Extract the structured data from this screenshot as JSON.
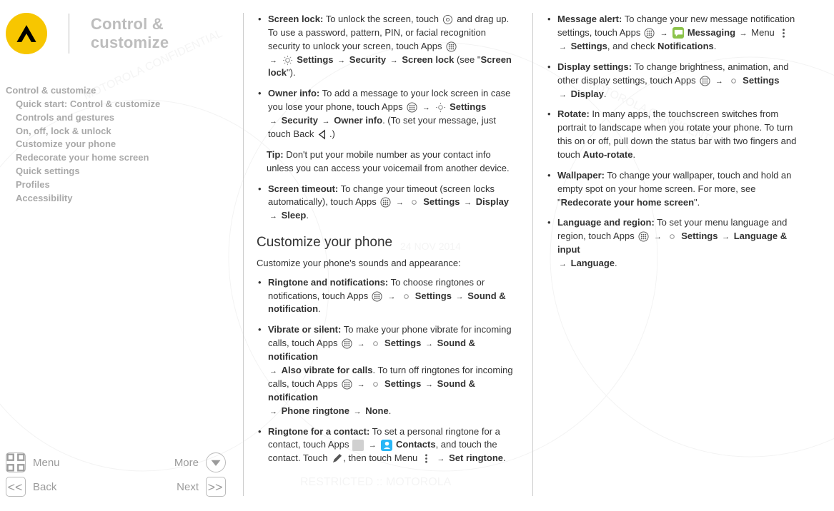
{
  "header": {
    "title": "Control & customize"
  },
  "toc": {
    "items": [
      {
        "label": "Control & customize",
        "level": 1
      },
      {
        "label": "Quick start: Control & customize",
        "level": 2
      },
      {
        "label": "Controls and gestures",
        "level": 2
      },
      {
        "label": "On, off, lock & unlock",
        "level": 2
      },
      {
        "label": "Customize your phone",
        "level": 2
      },
      {
        "label": "Redecorate your home screen",
        "level": 2
      },
      {
        "label": "Quick settings",
        "level": 2
      },
      {
        "label": "Profiles",
        "level": 2
      },
      {
        "label": "Accessibility",
        "level": 2
      }
    ]
  },
  "nav": {
    "menu": "Menu",
    "more": "More",
    "back": "Back",
    "next": "Next"
  },
  "col1": {
    "screen_lock": {
      "title": "Screen lock:",
      "t1": " To unlock the screen, touch ",
      "t2": " and drag up. To use a password, pattern, PIN, or facial recognition security to unlock your screen, touch Apps ",
      "p_settings": "Settings",
      "p_security": "Security",
      "p_screenlock": "Screen lock",
      "t3": " (see \"",
      "p_screenlock_link": "Screen lock",
      "t4": "\")."
    },
    "owner_info": {
      "title": "Owner info:",
      "t1": " To add a message to your lock screen in case you lose your phone, touch Apps ",
      "p_settings": "Settings",
      "p_security": "Security",
      "p_owner": "Owner info",
      "t2": ". (To set your message, just touch Back ",
      "t3": ".)"
    },
    "tip": {
      "title": "Tip:",
      "text": " Don't put your mobile number as your contact info unless you can access your voicemail from another device."
    },
    "screen_timeout": {
      "title": "Screen timeout:",
      "t1": " To change your timeout (screen locks automatically), touch Apps ",
      "p_settings": "Settings",
      "p_display": "Display",
      "p_sleep": "Sleep",
      "t2": "."
    },
    "heading": "Customize your phone",
    "intro": "Customize your phone's sounds and appearance:",
    "ringtone": {
      "title": "Ringtone and notifications:",
      "t1": " To choose ringtones or notifications, touch Apps ",
      "p_settings": "Settings",
      "p_sound": "Sound & notification",
      "t2": "."
    },
    "vibrate": {
      "title": "Vibrate or silent:",
      "t1": " To make your phone vibrate for incoming calls, touch Apps ",
      "p_settings": "Settings",
      "p_sound": "Sound & notification",
      "p_also": "Also vibrate for calls",
      "t2": ". To turn off ringtones for incoming calls, touch Apps ",
      "p_sound2": "Sound & notification",
      "p_ringtone": "Phone ringtone",
      "p_none": "None",
      "t3": "."
    },
    "contact_ringtone": {
      "title": "Ringtone for a contact:",
      "t1": " To set a personal ringtone for a contact, touch Apps ",
      "p_contacts": "Contacts",
      "t2": ", and touch the contact. Touch ",
      "t3": ", then touch Menu ",
      "p_set": "Set ringtone",
      "t4": "."
    }
  },
  "col2": {
    "msg_alert": {
      "title": "Message alert:",
      "t1": " To change your new message notification settings, touch Apps ",
      "p_messaging": "Messaging",
      "t2": " Menu ",
      "p_settings": "Settings",
      "t3": ", and check ",
      "p_notifications": "Notifications",
      "t4": "."
    },
    "display": {
      "title": "Display settings:",
      "t1": " To change brightness, animation, and other display settings, touch Apps ",
      "p_settings": "Settings",
      "p_display": "Display",
      "t2": "."
    },
    "rotate": {
      "title": "Rotate:",
      "t1": " In many apps, the touchscreen switches from portrait to landscape when you rotate your phone. To turn this on or off, pull down the status bar with two fingers and touch ",
      "p_auto": "Auto-rotate",
      "t2": "."
    },
    "wallpaper": {
      "title": "Wallpaper:",
      "t1": " To change your wallpaper, touch and hold an empty spot on your home screen. For more, see \"",
      "p_link": "Redecorate your home screen",
      "t2": "\"."
    },
    "language": {
      "title": "Language and region:",
      "t1": " To set your menu language and region, touch Apps ",
      "p_settings": "Settings",
      "p_lang_input": "Language & input",
      "p_lang": "Language",
      "t2": "."
    }
  }
}
